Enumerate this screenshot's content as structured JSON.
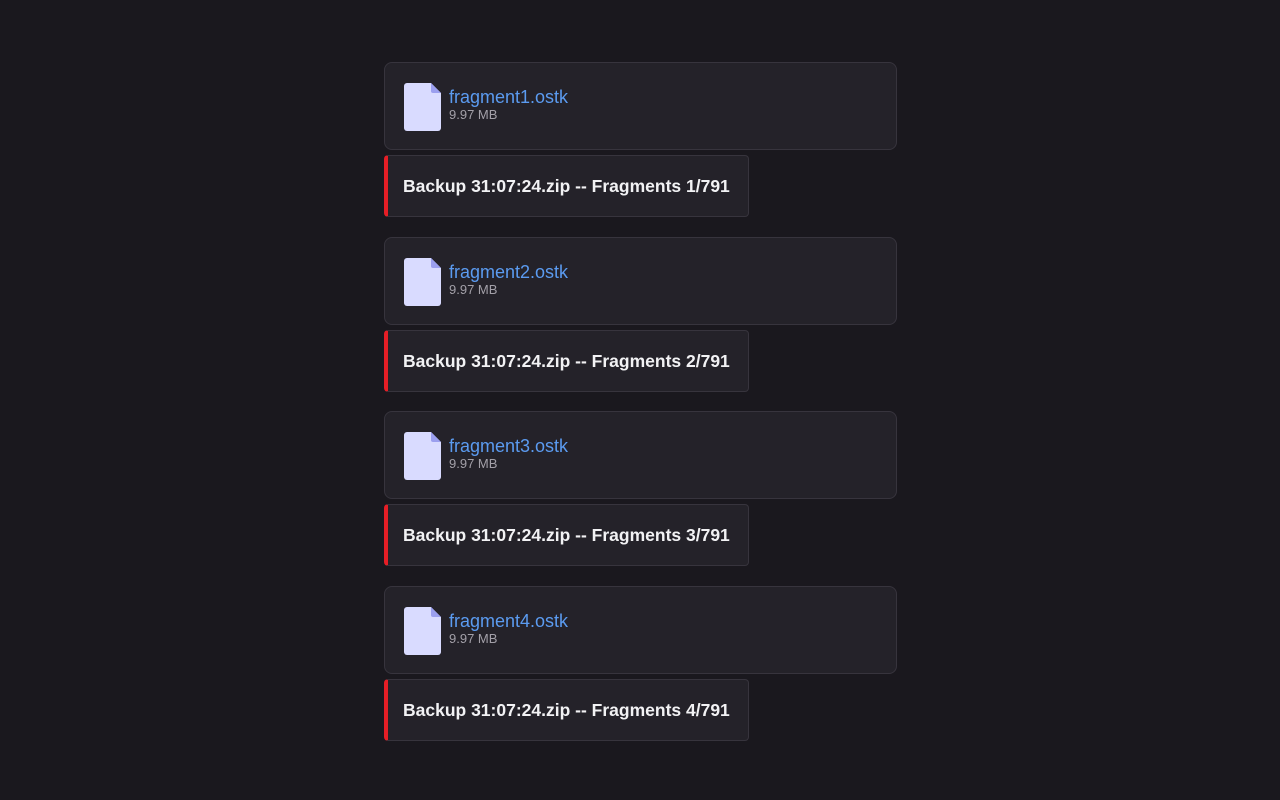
{
  "messages": [
    {
      "file_name": "fragment1.ostk",
      "file_size": "9.97 MB",
      "embed_title": "Backup 31:07:24.zip -- Fragments 1/791"
    },
    {
      "file_name": "fragment2.ostk",
      "file_size": "9.97 MB",
      "embed_title": "Backup 31:07:24.zip -- Fragments 2/791"
    },
    {
      "file_name": "fragment3.ostk",
      "file_size": "9.97 MB",
      "embed_title": "Backup 31:07:24.zip -- Fragments 3/791"
    },
    {
      "file_name": "fragment4.ostk",
      "file_size": "9.97 MB",
      "embed_title": "Backup 31:07:24.zip -- Fragments 4/791"
    }
  ],
  "icons": {
    "file": "file-icon"
  },
  "colors": {
    "background": "#1a181e",
    "card": "#242229",
    "link": "#5b9bf0",
    "embed_accent": "#e61e26",
    "icon_body": "#d9dbff",
    "icon_fold": "#9b9fef"
  }
}
